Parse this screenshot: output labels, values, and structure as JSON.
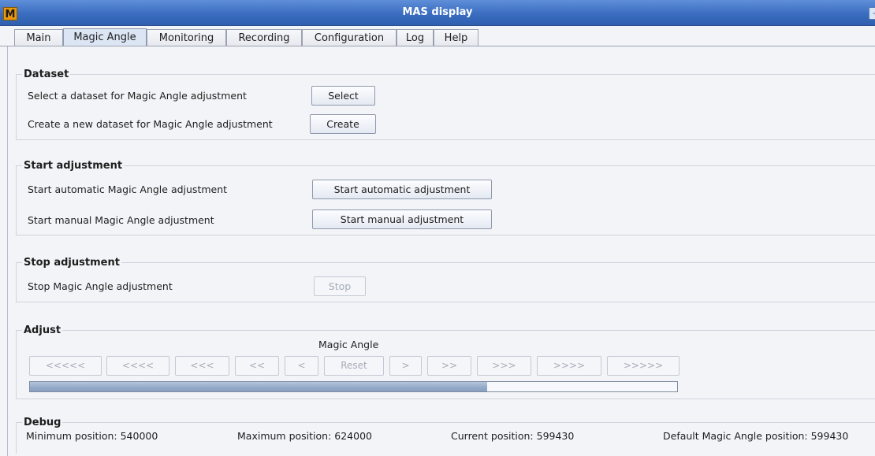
{
  "window": {
    "title": "MAS display",
    "app_icon_letter": "M",
    "corner_btn": "-"
  },
  "tabs": [
    {
      "label": "Main"
    },
    {
      "label": "Magic Angle",
      "active": true
    },
    {
      "label": "Monitoring"
    },
    {
      "label": "Recording"
    },
    {
      "label": "Configuration"
    },
    {
      "label": "Log"
    },
    {
      "label": "Help"
    }
  ],
  "dataset": {
    "legend": "Dataset",
    "select_label": "Select a dataset for Magic Angle adjustment",
    "select_button": "Select",
    "create_label": "Create a new dataset for Magic Angle adjustment",
    "create_button": "Create"
  },
  "start": {
    "legend": "Start adjustment",
    "auto_label": "Start automatic Magic Angle adjustment",
    "auto_button": "Start automatic adjustment",
    "manual_label": "Start manual Magic Angle adjustment",
    "manual_button": "Start manual adjustment"
  },
  "stop": {
    "legend": "Stop adjustment",
    "label": "Stop Magic Angle adjustment",
    "button": "Stop"
  },
  "adjust": {
    "legend": "Adjust",
    "caption": "Magic Angle",
    "buttons": [
      "<<<<<",
      "<<<<",
      "<<<",
      "<<",
      "<",
      "Reset",
      ">",
      ">>",
      ">>>",
      ">>>>",
      ">>>>>"
    ],
    "progress_fraction": 0.707
  },
  "debug": {
    "legend": "Debug",
    "min": "Minimum position: 540000",
    "max": "Maximum position: 624000",
    "current": "Current position: 599430",
    "default": "Default Magic Angle position: 599430"
  },
  "colors": {
    "titlebar": "#3a6dc0",
    "progress_fill": "#93a9c8",
    "active_tab": "#dbe5f4"
  }
}
